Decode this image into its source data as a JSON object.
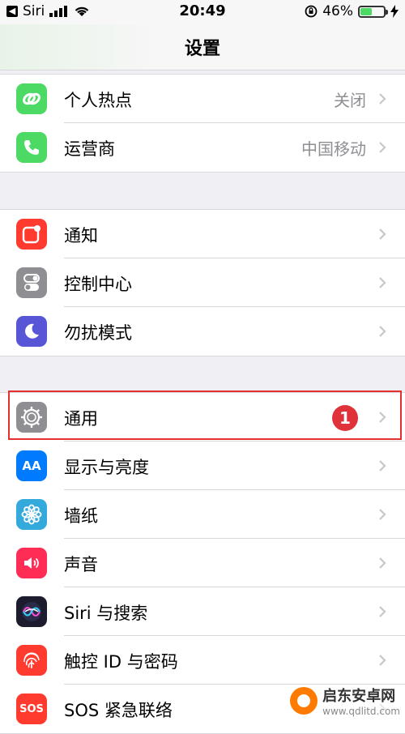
{
  "status_bar": {
    "carrier": "Siri",
    "time": "20:49",
    "battery_percent": "46%",
    "battery_level": 0.46,
    "back_glyph": "◀"
  },
  "nav": {
    "title": "设置"
  },
  "groups": [
    {
      "items": [
        {
          "label": "个人热点",
          "value": "关闭",
          "icon": "link-icon",
          "color": "#4cd964"
        },
        {
          "label": "运营商",
          "value": "中国移动",
          "icon": "phone-icon",
          "color": "#4cd964"
        }
      ]
    },
    {
      "items": [
        {
          "label": "通知",
          "icon": "notification-icon",
          "color": "#ff3b30"
        },
        {
          "label": "控制中心",
          "icon": "toggle-icon",
          "color": "#8e8e93"
        },
        {
          "label": "勿扰模式",
          "icon": "moon-icon",
          "color": "#5856d6"
        }
      ]
    },
    {
      "items": [
        {
          "label": "通用",
          "badge": "1",
          "icon": "gear-icon",
          "color": "#8e8e93"
        },
        {
          "label": "显示与亮度",
          "icon": "text-size-icon",
          "color": "#007aff",
          "icon_text": "AA"
        },
        {
          "label": "墙纸",
          "icon": "flower-icon",
          "color": "#34aadc"
        },
        {
          "label": "声音",
          "icon": "speaker-icon",
          "color": "#ff2d55"
        },
        {
          "label": "Siri 与搜索",
          "icon": "siri-icon",
          "color": "#1c1c2e"
        },
        {
          "label": "触控 ID 与密码",
          "icon": "fingerprint-icon",
          "color": "#ff3b30"
        },
        {
          "label": "SOS 紧急联络",
          "icon": "sos-icon",
          "color": "#ff3b30",
          "icon_text": "SOS"
        }
      ]
    }
  ],
  "watermark": {
    "title": "启东安卓网",
    "url": "www.qdlitd.com"
  }
}
